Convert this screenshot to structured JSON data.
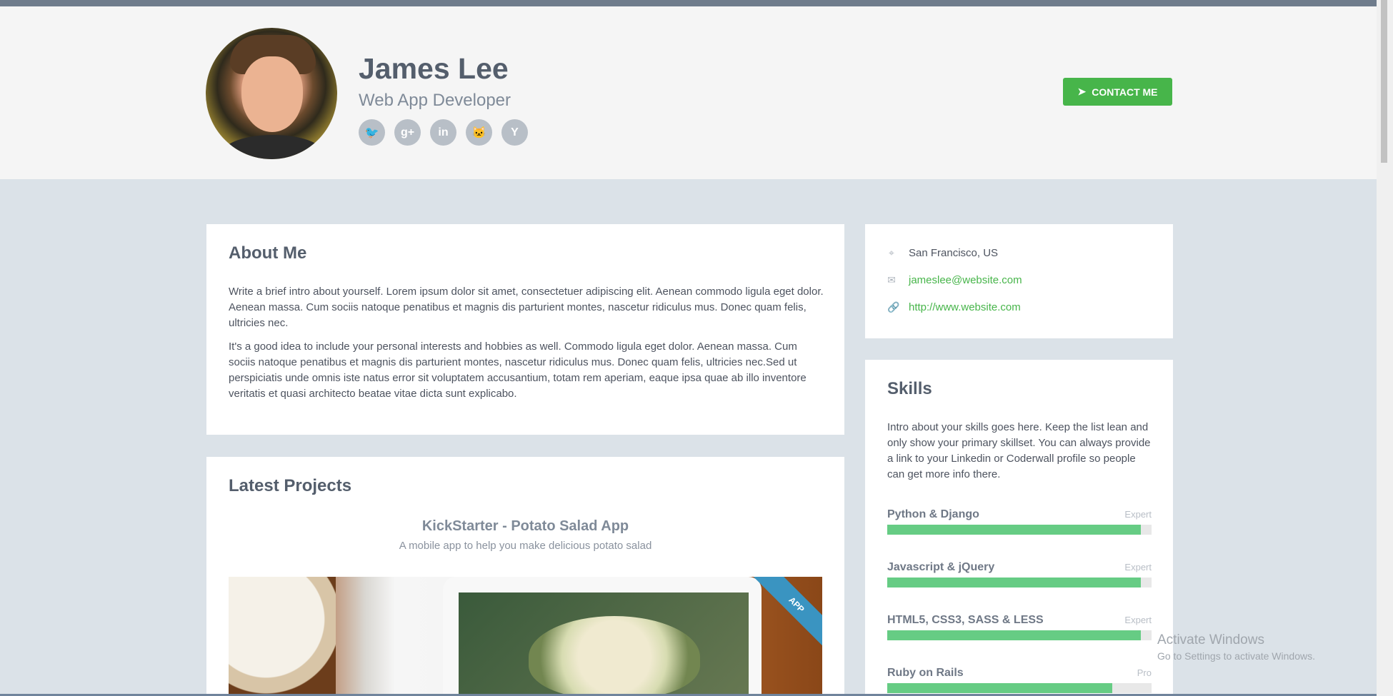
{
  "header": {
    "name": "James Lee",
    "role": "Web App Developer",
    "social_icons": [
      {
        "name": "twitter-icon",
        "glyph": "🐦"
      },
      {
        "name": "google-plus-icon",
        "glyph": "g+"
      },
      {
        "name": "linkedin-icon",
        "glyph": "in"
      },
      {
        "name": "github-icon",
        "glyph": "🐱"
      },
      {
        "name": "hacker-news-icon",
        "glyph": "Y"
      }
    ],
    "contact_button": {
      "icon": "paper-plane-icon",
      "icon_glyph": "➤",
      "label": "CONTACT ME"
    }
  },
  "about": {
    "title": "About Me",
    "paragraph_1": "Write a brief intro about yourself. Lorem ipsum dolor sit amet, consectetuer adipiscing elit. Aenean commodo ligula eget dolor. Aenean massa. Cum sociis natoque penatibus et magnis dis parturient montes, nascetur ridiculus mus. Donec quam felis, ultricies nec.",
    "paragraph_2": "It's a good idea to include your personal interests and hobbies as well. Commodo ligula eget dolor. Aenean massa. Cum sociis natoque penatibus et magnis dis parturient montes, nascetur ridiculus mus. Donec quam felis, ultricies nec.Sed ut perspiciatis unde omnis iste natus error sit voluptatem accusantium, totam rem aperiam, eaque ipsa quae ab illo inventore veritatis et quasi architecto beatae vitae dicta sunt explicabo."
  },
  "projects": {
    "title": "Latest Projects",
    "project_title": "KickStarter - Potato Salad App",
    "project_subtitle": "A mobile app to help you make delicious potato salad",
    "ribbon": "APP"
  },
  "info": {
    "location_icon": "map-marker-icon",
    "location_glyph": "⌖",
    "location": "San Francisco, US",
    "email_icon": "envelope-icon",
    "email_glyph": "✉",
    "email": "jameslee@website.com",
    "website_icon": "link-icon",
    "website_glyph": "🔗",
    "website": "http://www.website.com"
  },
  "skills": {
    "title": "Skills",
    "intro": "Intro about your skills goes here. Keep the list lean and only show your primary skillset. You can always provide a link to your Linkedin or Coderwall profile so people can get more info there.",
    "items": [
      {
        "name": "Python & Django",
        "level": "Expert",
        "progress": 0.96
      },
      {
        "name": "Javascript & jQuery",
        "level": "Expert",
        "progress": 0.96
      },
      {
        "name": "HTML5, CSS3, SASS & LESS",
        "level": "Expert",
        "progress": 0.96
      },
      {
        "name": "Ruby on Rails",
        "level": "Pro",
        "progress": 0.85
      }
    ]
  },
  "watermark": {
    "title": "Activate Windows",
    "subtitle": "Go to Settings to activate Windows."
  },
  "colors": {
    "accent_green": "#47b54a",
    "skill_green": "#66cc84",
    "ribbon_blue": "#3a94c1"
  }
}
